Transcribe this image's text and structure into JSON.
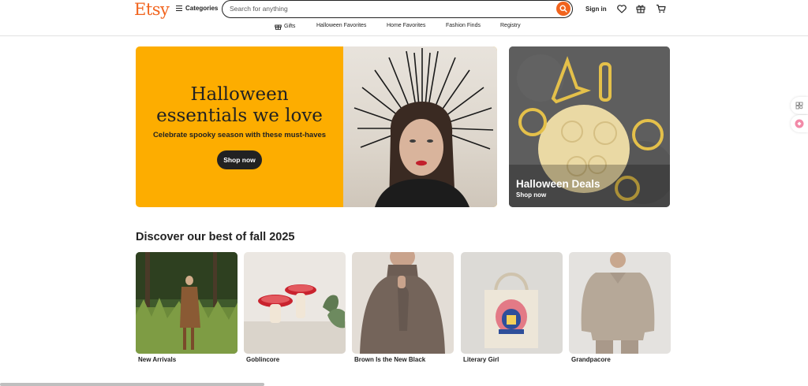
{
  "header": {
    "logo": "Etsy",
    "categories_label": "Categories",
    "search_placeholder": "Search for anything",
    "signin_label": "Sign in"
  },
  "subnav": [
    {
      "label": "Gifts",
      "icon": "gift-icon"
    },
    {
      "label": "Halloween Favorites"
    },
    {
      "label": "Home Favorites"
    },
    {
      "label": "Fashion Finds"
    },
    {
      "label": "Registry"
    }
  ],
  "hero": {
    "title_line1": "Halloween",
    "title_line2": "essentials we love",
    "subtitle": "Celebrate spooky season with these must-haves",
    "button_label": "Shop now"
  },
  "side_promo": {
    "title": "Halloween Deals",
    "link": "Shop now"
  },
  "discover": {
    "title": "Discover our best of fall 2025",
    "cards": [
      {
        "label": "New Arrivals"
      },
      {
        "label": "Goblincore"
      },
      {
        "label": "Brown Is the New Black"
      },
      {
        "label": "Literary Girl"
      },
      {
        "label": "Grandpacore"
      }
    ]
  },
  "colors": {
    "brand": "#f1641e",
    "hero_bg": "#fdad00",
    "text": "#222222"
  }
}
